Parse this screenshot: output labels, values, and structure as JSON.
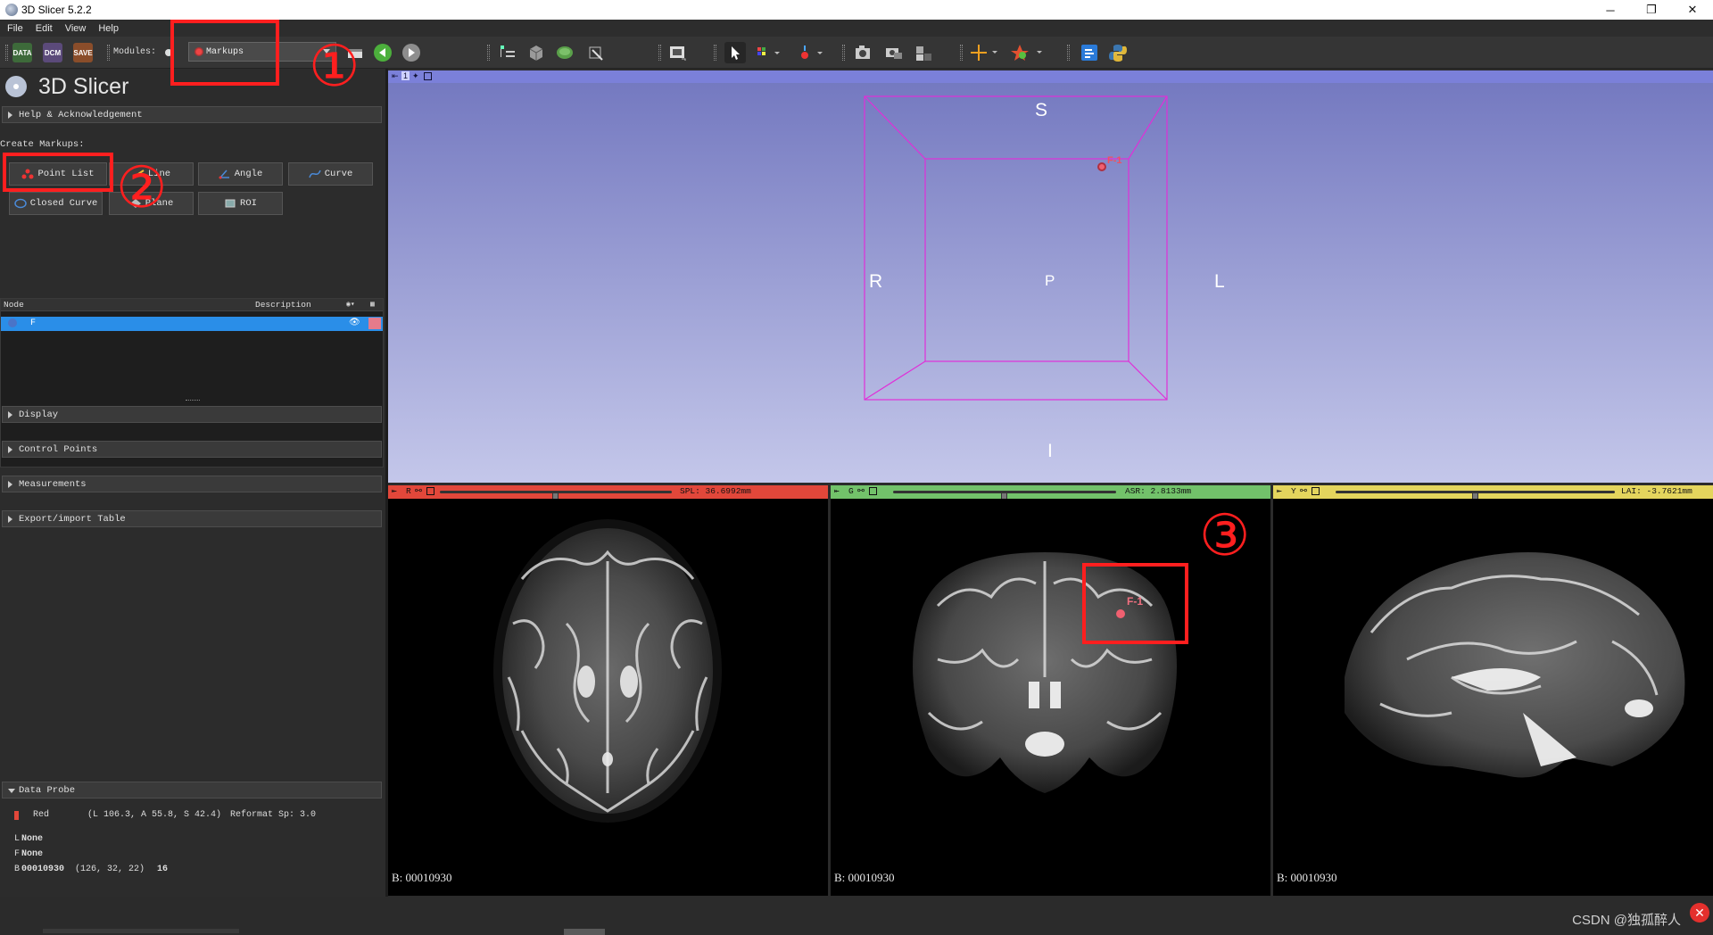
{
  "window": {
    "title": "3D Slicer 5.2.2",
    "minimize": "─",
    "maximize": "❐",
    "close": "✕"
  },
  "menu": [
    "File",
    "Edit",
    "View",
    "Help"
  ],
  "toolbar": {
    "data_label": "DATA",
    "dcm_label": "DCM",
    "save_label": "SAVE",
    "modules_label": "Modules:",
    "module_selected": "Markups"
  },
  "panel": {
    "logo_text": "3D Slicer",
    "help_section": "Help & Acknowledgement",
    "create_markups_label": "Create Markups:",
    "buttons": [
      "Point List",
      "Line",
      "Angle",
      "Curve",
      "Closed Curve",
      "Plane",
      "ROI"
    ],
    "node_table": {
      "col_node": "Node",
      "col_description": "Description",
      "row_name": "F"
    },
    "sections": [
      "Display",
      "Control Points",
      "Measurements",
      "Export/import Table"
    ],
    "data_probe": {
      "title": "Data Probe",
      "view": "Red",
      "coords": "(L 106.3, A 55.8, S 42.4)",
      "reformat": "Reformat Sp: 3.0",
      "rows": [
        {
          "key": "L",
          "name": "None",
          "extra": ""
        },
        {
          "key": "F",
          "name": "None",
          "extra": ""
        },
        {
          "key": "B",
          "name": "00010930",
          "extra": "(126,   32,   22)",
          "value": "16"
        }
      ]
    }
  },
  "view3d": {
    "tab": "1",
    "labels": {
      "top": "S",
      "left": "R",
      "center": "P",
      "right": "L",
      "bottom": "I"
    },
    "point_label": "F-1"
  },
  "slices": [
    {
      "id": "R",
      "color": "#e2473a",
      "readout": "SPL: 36.6992mm",
      "volume": "B: 00010930",
      "slider": 0.5
    },
    {
      "id": "G",
      "color": "#72c26a",
      "readout": "ASR: 2.8133mm",
      "volume": "B: 00010930",
      "slider": 0.5
    },
    {
      "id": "Y",
      "color": "#e4d55d",
      "readout": "LAI: -3.7621mm",
      "volume": "B: 00010930",
      "slider": 0.5
    }
  ],
  "green_point_label": "F-1",
  "annotations": {
    "one": "①",
    "two": "②",
    "three": "③"
  },
  "watermark": "CSDN @独孤醉人",
  "colors": {
    "accent_selected": "#2a8ee8",
    "annotation_red": "#ff1f1f",
    "roi_magenta": "#e02fd8"
  }
}
